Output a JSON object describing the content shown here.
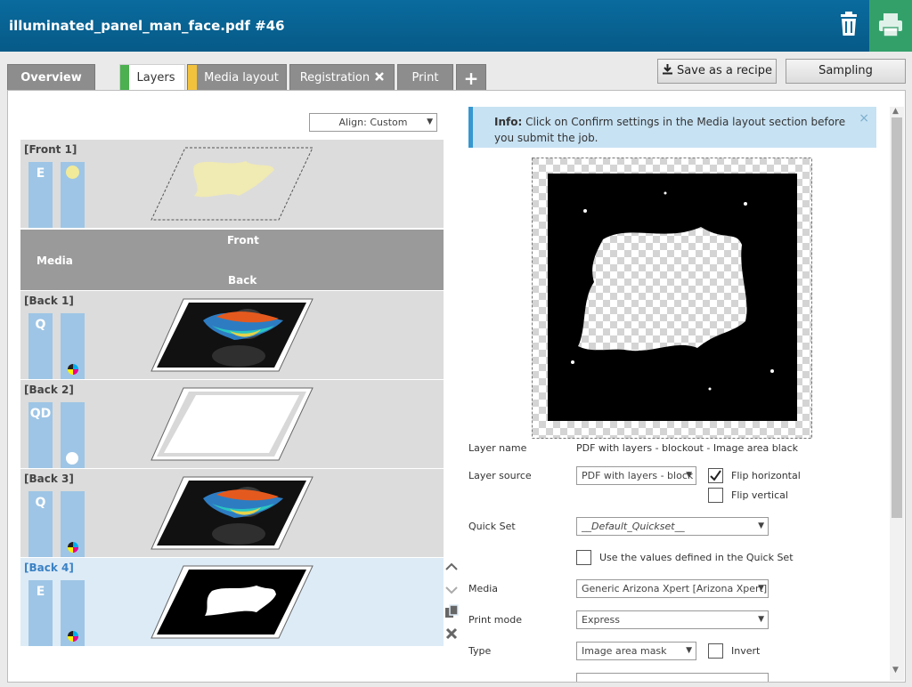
{
  "header": {
    "title": "illuminated_panel_man_face.pdf #46"
  },
  "tabs": [
    {
      "label": "Overview"
    },
    {
      "label": "Layers",
      "color": "#4caf50"
    },
    {
      "label": "Media layout",
      "color": "#f3c23c"
    },
    {
      "label": "Registration"
    },
    {
      "label": "Print"
    },
    {
      "label": "+"
    }
  ],
  "buttons": {
    "save_recipe": "Save as a recipe",
    "sampling": "Sampling"
  },
  "align": {
    "label": "Align: Custom"
  },
  "layers": [
    {
      "name": "[Front 1]",
      "channel": "E",
      "indicator": "yellow-dot"
    },
    {
      "name": "[Back 1]",
      "channel": "Q",
      "indicator": "cmyk"
    },
    {
      "name": "[Back 2]",
      "channel": "QD",
      "indicator": "white-dot"
    },
    {
      "name": "[Back 3]",
      "channel": "Q",
      "indicator": "cmyk"
    },
    {
      "name": "[Back 4]",
      "channel": "E",
      "indicator": "cmyk"
    }
  ],
  "media": {
    "label": "Media",
    "front": "Front",
    "back": "Back"
  },
  "info": {
    "title": "Info:",
    "text": "Click on Confirm settings in the Media layout section before you submit the job.",
    "close": "×"
  },
  "form": {
    "layer_name_label": "Layer name",
    "layer_name_value": "PDF with layers - blockout - Image area black",
    "layer_source_label": "Layer source",
    "layer_source_value": "PDF with layers - block",
    "flip_horizontal": "Flip horizontal",
    "flip_vertical": "Flip vertical",
    "quick_set_label": "Quick Set",
    "quick_set_value": "__Default_Quickset__",
    "use_quickset": "Use the values defined in the Quick Set",
    "media_label": "Media",
    "media_value": "Generic Arizona Xpert [Arizona Xpert]",
    "print_mode_label": "Print mode",
    "print_mode_value": "Express",
    "type_label": "Type",
    "type_value": "Image area mask",
    "invert": "Invert"
  },
  "colors": {
    "header_bg": "#0a6b9e",
    "print_button": "#33a06a",
    "channel_bar": "#9ec5e5",
    "selected_layer": "#ddebf7",
    "info_bg": "#c7e2f3"
  }
}
